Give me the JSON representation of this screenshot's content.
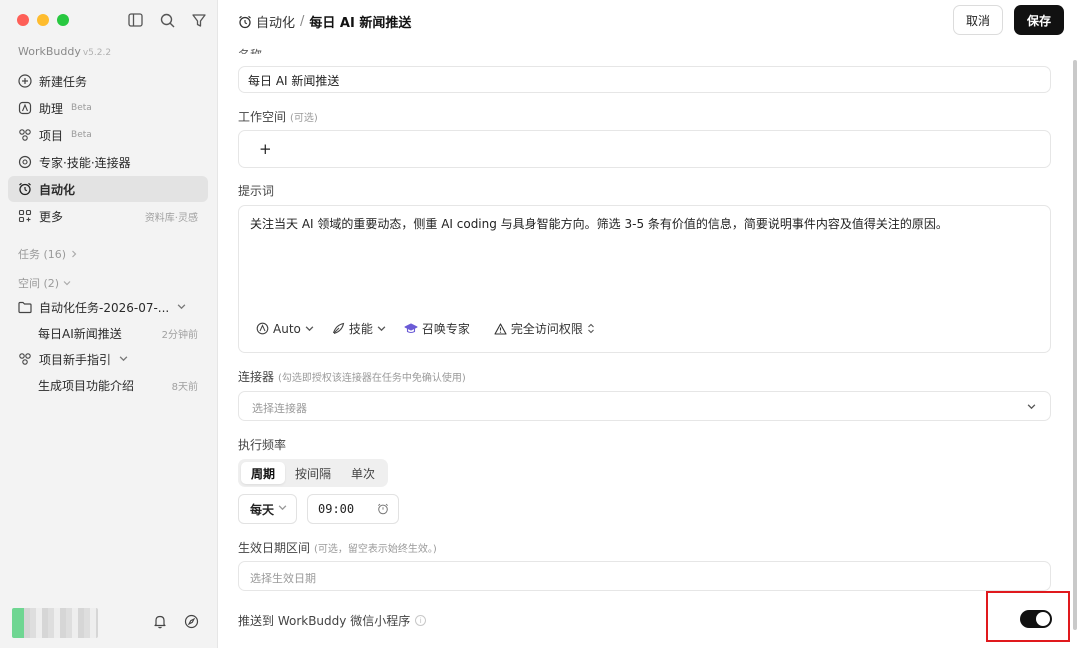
{
  "app": {
    "name": "WorkBuddy",
    "version": "v5.2.2"
  },
  "sidebar": {
    "nav": [
      {
        "label": "新建任务",
        "icon": "plus-circle-icon"
      },
      {
        "label": "助理",
        "badge": "Beta",
        "icon": "assistant-icon"
      },
      {
        "label": "项目",
        "badge": "Beta",
        "icon": "project-icon"
      },
      {
        "label": "专家·技能·连接器",
        "icon": "expert-icon"
      },
      {
        "label": "自动化",
        "icon": "alarm-clock-icon",
        "active": true
      },
      {
        "label": "更多",
        "right": "资料库·灵感",
        "icon": "grid-icon"
      }
    ],
    "tasks_section": "任务 (16)",
    "spaces_section": "空间 (2)",
    "tree": [
      {
        "label": "自动化任务-2026-07-...",
        "icon": "folder-icon"
      },
      {
        "label": "每日AI新闻推送",
        "time": "2分钟前"
      },
      {
        "label": "项目新手指引",
        "icon": "project-icon"
      },
      {
        "label": "生成项目功能介绍",
        "time": "8天前"
      }
    ]
  },
  "header": {
    "breadcrumb_parent": "自动化",
    "breadcrumb_sep": "/",
    "breadcrumb_current": "每日 AI 新闻推送",
    "cancel_label": "取消",
    "save_label": "保存"
  },
  "form": {
    "name_label_clipped": "名称",
    "name_value": "每日 AI 新闻推送",
    "workspace_label": "工作空间",
    "workspace_optional": "(可选)",
    "workspace_add": "+",
    "prompt_label": "提示词",
    "prompt_value": "关注当天 AI 领域的重要动态，侧重 AI coding 与具身智能方向。筛选 3-5 条有价值的信息，简要说明事件内容及值得关注的原因。",
    "prompt_tools": {
      "model": "Auto",
      "skills": "技能",
      "expert": "召唤专家",
      "access": "完全访问权限"
    },
    "connector_label": "连接器",
    "connector_hint": "(勾选即授权该连接器在任务中免确认使用)",
    "connector_placeholder": "选择连接器",
    "frequency_label": "执行频率",
    "frequency_tabs": [
      "周期",
      "按间隔",
      "单次"
    ],
    "frequency_selected": "周期",
    "period_value": "每天",
    "time_value": "09:00",
    "date_range_label": "生效日期区间",
    "date_range_hint": "(可选，留空表示始终生效。)",
    "date_range_placeholder": "选择生效日期",
    "push_label": "推送到 WorkBuddy 微信小程序",
    "push_info": "i",
    "push_enabled": true
  },
  "colors": {
    "accent": "#111111",
    "highlight": "#e0191d",
    "sidebar_bg": "#f3f3f3"
  }
}
